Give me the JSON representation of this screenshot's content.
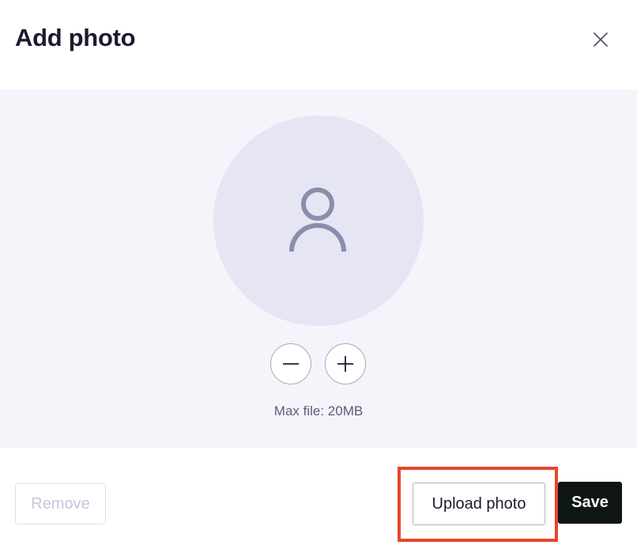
{
  "dialog": {
    "title": "Add photo",
    "close_icon": "close-icon"
  },
  "preview": {
    "avatar_icon": "user-silhouette-icon",
    "zoom_out_icon": "minus-icon",
    "zoom_in_icon": "plus-icon",
    "max_file_text": "Max file: 20MB"
  },
  "footer": {
    "remove_label": "Remove",
    "upload_label": "Upload photo",
    "save_label": "Save"
  },
  "colors": {
    "preview_background": "#f4f4fb",
    "avatar_background": "#e5e5f4",
    "avatar_icon": "#8c8cad",
    "save_background": "#0e1616",
    "highlight": "#e8452a"
  }
}
